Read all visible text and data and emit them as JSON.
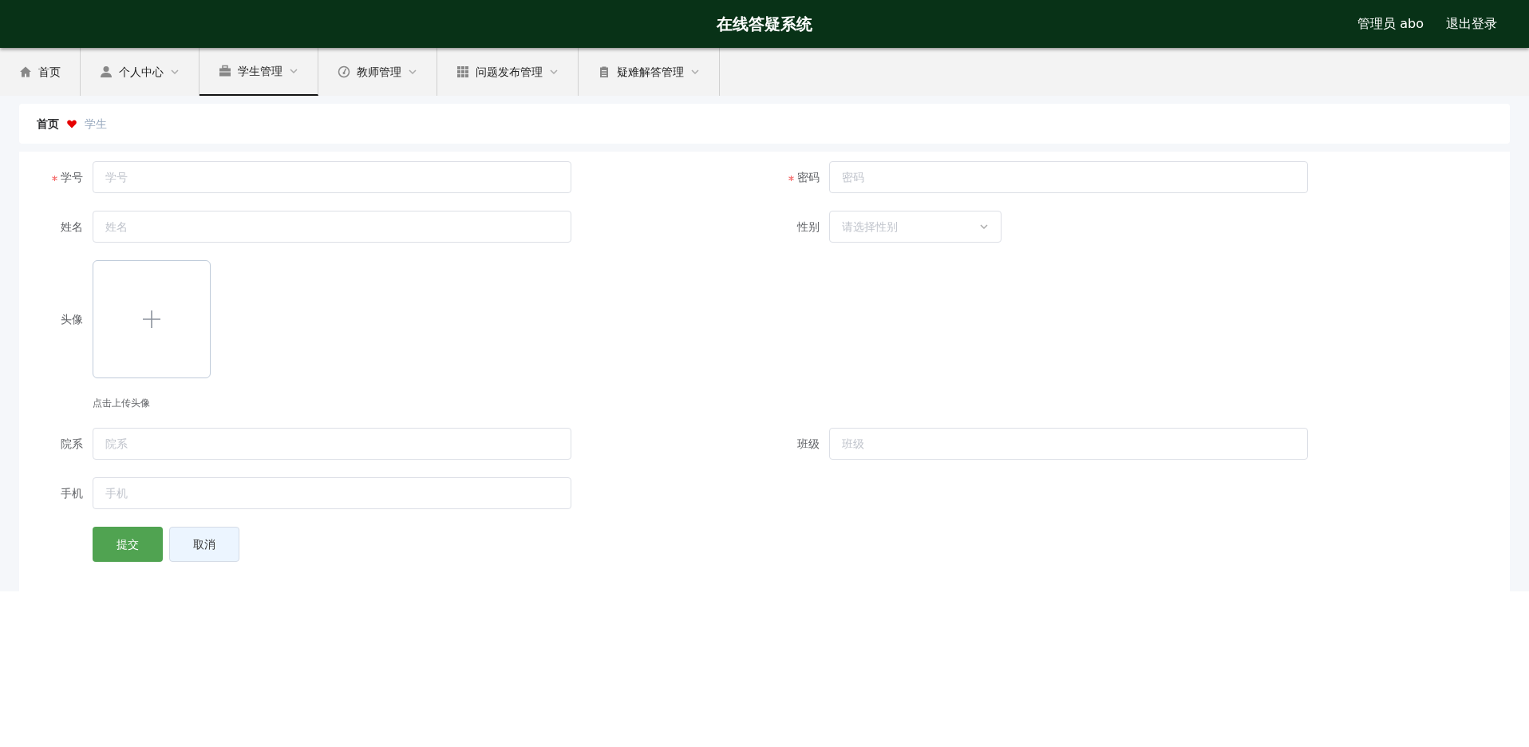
{
  "header": {
    "title": "在线答疑系统",
    "user": "管理员 abo",
    "logout": "退出登录"
  },
  "nav": [
    {
      "label": "首页",
      "dropdown": false,
      "selected": false
    },
    {
      "label": "个人中心",
      "dropdown": true,
      "selected": false
    },
    {
      "label": "学生管理",
      "dropdown": true,
      "selected": true
    },
    {
      "label": "教师管理",
      "dropdown": true,
      "selected": false
    },
    {
      "label": "问题发布管理",
      "dropdown": true,
      "selected": false
    },
    {
      "label": "疑难解答管理",
      "dropdown": true,
      "selected": false
    }
  ],
  "breadcrumb": [
    "首页",
    "学生"
  ],
  "form": {
    "rows": [
      [
        {
          "kind": "input",
          "label": "学号",
          "required": true,
          "placeholder": "学号"
        },
        {
          "kind": "input",
          "label": "密码",
          "required": true,
          "placeholder": "密码"
        }
      ],
      [
        {
          "kind": "input",
          "label": "姓名",
          "required": false,
          "placeholder": "姓名"
        },
        {
          "kind": "select",
          "label": "性别",
          "required": false,
          "placeholder": "请选择性别"
        }
      ],
      [
        {
          "kind": "upload",
          "label": "头像",
          "required": false,
          "hint": "点击上传头像"
        }
      ],
      [
        {
          "kind": "input",
          "label": "院系",
          "required": false,
          "placeholder": "院系"
        },
        {
          "kind": "input",
          "label": "班级",
          "required": false,
          "placeholder": "班级"
        }
      ],
      [
        {
          "kind": "input",
          "label": "手机",
          "required": false,
          "placeholder": "手机"
        }
      ]
    ],
    "buttons": [
      {
        "label": "提交",
        "kind": "primary"
      },
      {
        "label": "取消",
        "kind": "secondary"
      }
    ]
  }
}
